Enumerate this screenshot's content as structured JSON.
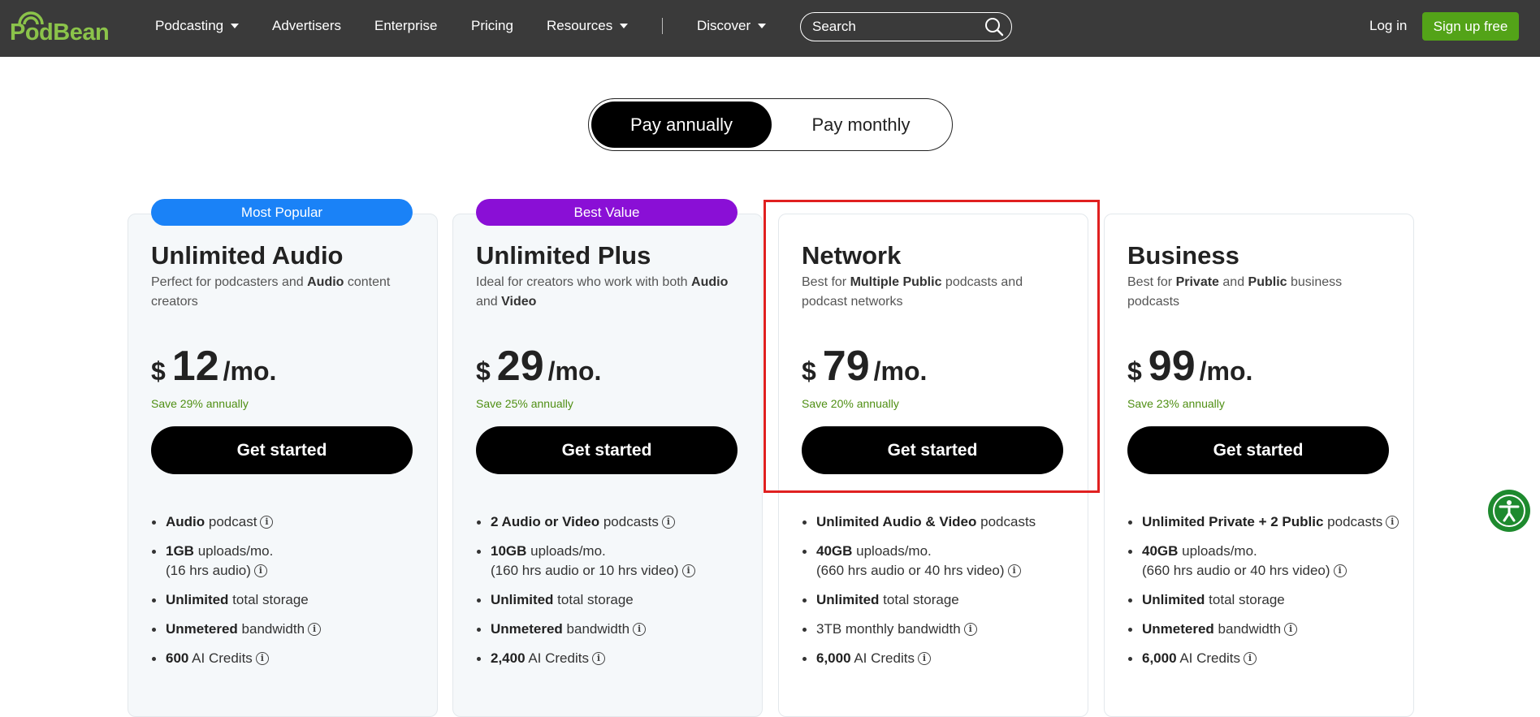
{
  "nav": {
    "logo_text": "PodBean",
    "items": [
      {
        "label": "Podcasting",
        "dropdown": true
      },
      {
        "label": "Advertisers",
        "dropdown": false
      },
      {
        "label": "Enterprise",
        "dropdown": false
      },
      {
        "label": "Pricing",
        "dropdown": false
      },
      {
        "label": "Resources",
        "dropdown": true
      },
      {
        "label": "Discover",
        "dropdown": true
      }
    ],
    "search_placeholder": "Search",
    "login_label": "Log in",
    "signup_label": "Sign up free"
  },
  "billing_toggle": {
    "active_label": "Pay annually",
    "inactive_label": "Pay monthly"
  },
  "plans": [
    {
      "ribbon": "Most Popular",
      "ribbon_color": "#1a82f7",
      "title": "Unlimited Audio",
      "desc": [
        {
          "t": "Perfect for podcasters and "
        },
        {
          "t": "Audio",
          "b": true
        },
        {
          "t": " content creators"
        }
      ],
      "currency": "$",
      "amount": "12",
      "per": "/mo.",
      "save": "Save 29% annually",
      "cta": "Get started",
      "features": [
        [
          {
            "t": "Audio",
            "b": true
          },
          {
            "t": " podcast"
          },
          {
            "i": true
          }
        ],
        [
          {
            "t": "1GB",
            "b": true
          },
          {
            "t": " uploads/mo."
          },
          {
            "br": true
          },
          {
            "t": "(16 hrs audio)"
          },
          {
            "i": true
          }
        ],
        [
          {
            "t": "Unlimited",
            "b": true
          },
          {
            "t": " total storage"
          }
        ],
        [
          {
            "t": "Unmetered",
            "b": true
          },
          {
            "t": " bandwidth"
          },
          {
            "i": true
          }
        ],
        [
          {
            "t": "600",
            "b": true
          },
          {
            "t": " AI Credits"
          },
          {
            "i": true
          }
        ]
      ]
    },
    {
      "ribbon": "Best Value",
      "ribbon_color": "#8a0fd6",
      "title": "Unlimited Plus",
      "desc": [
        {
          "t": "Ideal for creators who work with both "
        },
        {
          "t": "Audio",
          "b": true
        },
        {
          "t": " and "
        },
        {
          "t": "Video",
          "b": true
        }
      ],
      "currency": "$",
      "amount": "29",
      "per": "/mo.",
      "save": "Save 25% annually",
      "cta": "Get started",
      "features": [
        [
          {
            "t": "2 Audio or Video",
            "b": true
          },
          {
            "t": " podcasts"
          },
          {
            "i": true
          }
        ],
        [
          {
            "t": "10GB",
            "b": true
          },
          {
            "t": " uploads/mo."
          },
          {
            "br": true
          },
          {
            "t": "(160 hrs audio or 10 hrs video)"
          },
          {
            "i": true
          }
        ],
        [
          {
            "t": "Unlimited",
            "b": true
          },
          {
            "t": " total storage"
          }
        ],
        [
          {
            "t": "Unmetered",
            "b": true
          },
          {
            "t": " bandwidth"
          },
          {
            "i": true
          }
        ],
        [
          {
            "t": "2,400",
            "b": true
          },
          {
            "t": " AI Credits"
          },
          {
            "i": true
          }
        ]
      ]
    },
    {
      "ribbon": "",
      "ribbon_color": "",
      "title": "Network",
      "desc": [
        {
          "t": "Best for "
        },
        {
          "t": "Multiple Public",
          "b": true
        },
        {
          "t": " podcasts and podcast networks"
        }
      ],
      "currency": "$",
      "amount": "79",
      "per": "/mo.",
      "save": "Save 20% annually",
      "cta": "Get started",
      "features": [
        [
          {
            "t": "Unlimited Audio & Video",
            "b": true
          },
          {
            "t": " podcasts"
          }
        ],
        [
          {
            "t": "40GB",
            "b": true
          },
          {
            "t": " uploads/mo."
          },
          {
            "br": true
          },
          {
            "t": "(660 hrs audio or 40 hrs video)"
          },
          {
            "i": true
          }
        ],
        [
          {
            "t": "Unlimited",
            "b": true
          },
          {
            "t": " total storage"
          }
        ],
        [
          {
            "t": "3TB monthly bandwidth"
          },
          {
            "i": true
          }
        ],
        [
          {
            "t": "6,000",
            "b": true
          },
          {
            "t": " AI Credits"
          },
          {
            "i": true
          }
        ]
      ]
    },
    {
      "ribbon": "",
      "ribbon_color": "",
      "title": "Business",
      "desc": [
        {
          "t": "Best for "
        },
        {
          "t": "Private",
          "b": true
        },
        {
          "t": " and "
        },
        {
          "t": "Public",
          "b": true
        },
        {
          "t": " business podcasts"
        }
      ],
      "currency": "$",
      "amount": "99",
      "per": "/mo.",
      "save": "Save 23% annually",
      "cta": "Get started",
      "features": [
        [
          {
            "t": "Unlimited Private + 2 Public",
            "b": true
          },
          {
            "t": " podcasts"
          },
          {
            "i": true
          }
        ],
        [
          {
            "t": "40GB",
            "b": true
          },
          {
            "t": " uploads/mo."
          },
          {
            "br": true
          },
          {
            "t": "(660 hrs audio or 40 hrs video)"
          },
          {
            "i": true
          }
        ],
        [
          {
            "t": "Unlimited",
            "b": true
          },
          {
            "t": " total storage"
          }
        ],
        [
          {
            "t": "Unmetered",
            "b": true
          },
          {
            "t": " bandwidth"
          },
          {
            "i": true
          }
        ],
        [
          {
            "t": "6,000",
            "b": true
          },
          {
            "t": " AI Credits"
          },
          {
            "i": true
          }
        ]
      ]
    }
  ],
  "icons": {
    "info": "info-circle-icon",
    "search": "search-icon",
    "accessibility": "accessibility-icon"
  },
  "colors": {
    "navbar_bg": "#3a3a3a",
    "signup_green": "#53a318",
    "save_green": "#4f8f13",
    "highlight_red": "#e02020"
  }
}
